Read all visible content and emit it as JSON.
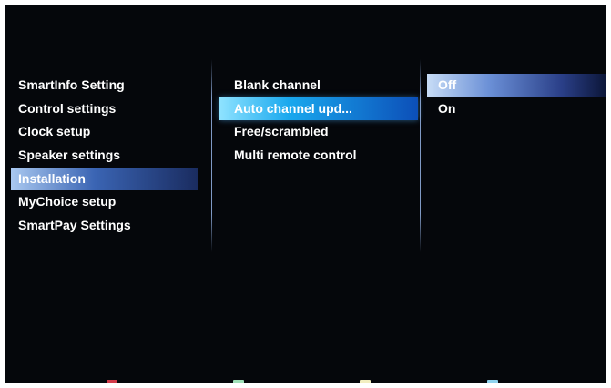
{
  "menu": {
    "items": [
      {
        "label": "SmartInfo Setting"
      },
      {
        "label": "Control settings"
      },
      {
        "label": "Clock setup"
      },
      {
        "label": "Speaker settings"
      },
      {
        "label": "Installation",
        "state": "selected"
      },
      {
        "label": "MyChoice setup"
      },
      {
        "label": "SmartPay Settings"
      }
    ]
  },
  "submenu": {
    "items": [
      {
        "label": "Blank channel"
      },
      {
        "label": "Auto channel upd...",
        "state": "focused"
      },
      {
        "label": "Free/scrambled"
      },
      {
        "label": "Multi remote control"
      }
    ]
  },
  "options": {
    "items": [
      {
        "label": "Off",
        "state": "selected"
      },
      {
        "label": "On"
      }
    ]
  },
  "color_keys": {
    "red": "#d23b4a",
    "green": "#9fe0b8",
    "yellow": "#f2eec0",
    "blue": "#8fd3ee"
  },
  "colors": {
    "background": "#05070b",
    "selected_highlight": "#3a64b3",
    "focused_highlight": "#19a8ee",
    "text": "#ffffff"
  }
}
